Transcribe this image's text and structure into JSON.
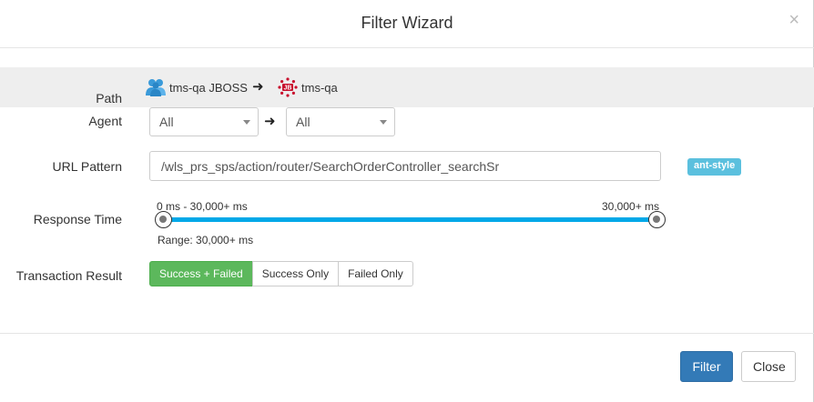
{
  "modal": {
    "title": "Filter Wizard",
    "close_glyph": "×"
  },
  "labels": {
    "path": "Path",
    "agent": "Agent",
    "url_pattern": "URL Pattern",
    "response_time": "Response Time",
    "transaction_result": "Transaction Result"
  },
  "path": {
    "from": {
      "name": "tms-qa JBOSS",
      "icon": "users-group-icon"
    },
    "arrow": "➜",
    "to": {
      "name": "tms-qa",
      "icon": "jboss-icon"
    }
  },
  "agent": {
    "from_value": "All",
    "arrow": "➜",
    "to_value": "All"
  },
  "url": {
    "value": "/wls_prs_sps/action/router/SearchOrderController_searchSr",
    "badge": "ant-style"
  },
  "response_time": {
    "range_left_text": "0 ms - 30,000+ ms",
    "range_right_text": "30,000+ ms",
    "summary": "Range: 30,000+ ms",
    "min_fraction": 0.0,
    "max_fraction": 1.0
  },
  "transaction_result": {
    "options": [
      "Success + Failed",
      "Success Only",
      "Failed Only"
    ],
    "selected": "Success + Failed"
  },
  "footer": {
    "filter_label": "Filter",
    "close_label": "Close"
  },
  "colors": {
    "primary": "#337ab7",
    "success": "#5cb85c",
    "info": "#5bc0de",
    "slider": "#00a8e8"
  }
}
